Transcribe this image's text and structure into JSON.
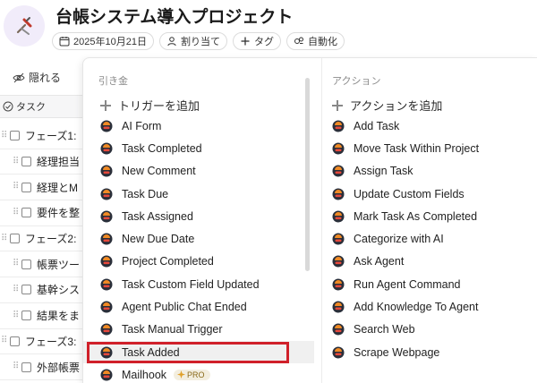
{
  "header": {
    "title": "台帳システム導入プロジェクト",
    "chips": [
      {
        "icon": "calendar-icon",
        "label": "2025年10月21日"
      },
      {
        "icon": "person-icon",
        "label": "割り当て"
      },
      {
        "icon": "plus-icon",
        "label": "タグ"
      },
      {
        "icon": "automation-icon",
        "label": "自動化"
      }
    ]
  },
  "left": {
    "hide_label": "隠れる",
    "column_header": "タスク",
    "rows": [
      {
        "type": "phase",
        "label": "フェーズ1:"
      },
      {
        "type": "sub",
        "label": "経理担当"
      },
      {
        "type": "sub",
        "label": "経理とM"
      },
      {
        "type": "sub",
        "label": "要件を整"
      },
      {
        "type": "phase",
        "label": "フェーズ2:"
      },
      {
        "type": "sub",
        "label": "帳票ツー"
      },
      {
        "type": "sub",
        "label": "基幹シス"
      },
      {
        "type": "sub",
        "label": "結果をま"
      },
      {
        "type": "phase",
        "label": "フェーズ3:"
      },
      {
        "type": "sub",
        "label": "外部帳票"
      }
    ]
  },
  "triggers": {
    "section_title": "引き金",
    "add_label": "トリガーを追加",
    "items": [
      "AI Form",
      "Task Completed",
      "New Comment",
      "Task Due",
      "Task Assigned",
      "New Due Date",
      "Project Completed",
      "Task Custom Field Updated",
      "Agent Public Chat Ended",
      "Task Manual Trigger",
      "Task Added",
      "Mailhook"
    ],
    "selected_item": "Task Added",
    "pro_badge": "PRO"
  },
  "actions": {
    "section_title": "アクション",
    "add_label": "アクションを追加",
    "items": [
      "Add Task",
      "Move Task Within Project",
      "Assign Task",
      "Update Custom Fields",
      "Mark Task As Completed",
      "Categorize with AI",
      "Ask Agent",
      "Run Agent Command",
      "Add Knowledge To Agent",
      "Search Web",
      "Scrape Webpage"
    ]
  },
  "colors": {
    "highlight_border": "#d0202a",
    "icon_dark": "#2a2f3a",
    "icon_orange": "#f08a24",
    "icon_red": "#e5483c",
    "avatar_bg": "#f1ecfa"
  }
}
